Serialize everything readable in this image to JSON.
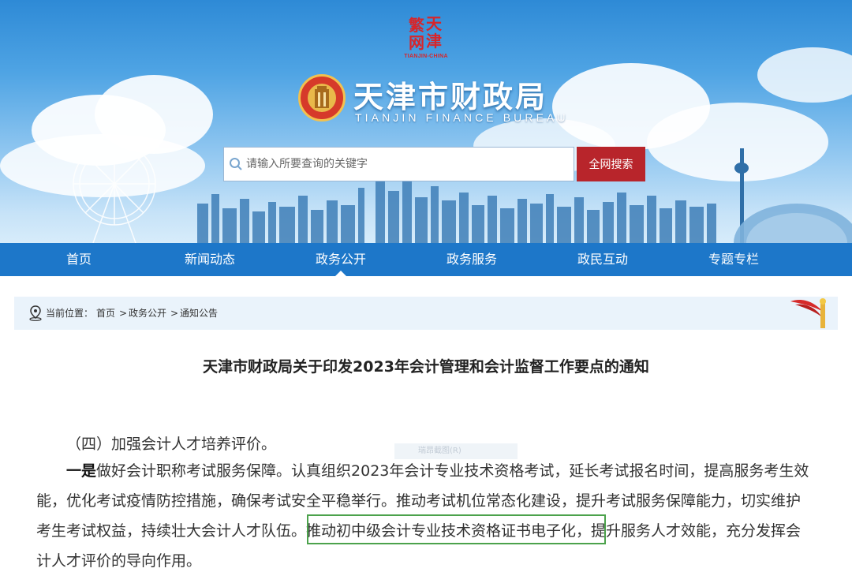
{
  "banner": {
    "seal": {
      "chars": [
        "天",
        "津",
        "繁",
        "网"
      ],
      "subtitle": "TIANJIN-CHINA"
    },
    "title": "天津市财政局",
    "subtitle": "TIANJIN FINANCE BUREAU"
  },
  "search": {
    "placeholder": "请输入所要查询的关键字",
    "button_label": "全网搜索"
  },
  "nav": {
    "items": [
      {
        "label": "首页"
      },
      {
        "label": "新闻动态"
      },
      {
        "label": "政务公开",
        "active": true
      },
      {
        "label": "政务服务"
      },
      {
        "label": "政民互动"
      },
      {
        "label": "专题专栏"
      }
    ]
  },
  "breadcrumb": {
    "label": "当前位置：",
    "items": [
      "首页",
      "政务公开",
      "通知公告"
    ],
    "separator": ">"
  },
  "article": {
    "title": "天津市财政局关于印发2023年会计管理和会计监督工作要点的通知",
    "section_heading": "（四）加强会计人才培养评价。",
    "lead_bold": "一是",
    "line1_rest": "做好会计职称考试服务保障。认真组织2023年会计专业技术资格考试，延长考试报名时间，提高服务考生效",
    "line2": "能，优化考试疫情防控措施，确保考试安全平稳举行。推动考试机位常态化建设，提升考试服务保障能力，切实维护",
    "line3_pre": "考生考试权益，持续壮大会计人才队伍。",
    "line3_highlight": "推动初中级会计专业技术资格证书电子化，",
    "line3_post": "提升服务人才效能，充分发挥会",
    "line4": "计人才评价的导向作用。",
    "watermark": "瑞昂截图(R)"
  },
  "colors": {
    "nav_bg": "#1d77c9",
    "search_button": "#b8252b",
    "breadcrumb_bg": "#eaf3fb",
    "highlight_border": "#4ca24c"
  }
}
